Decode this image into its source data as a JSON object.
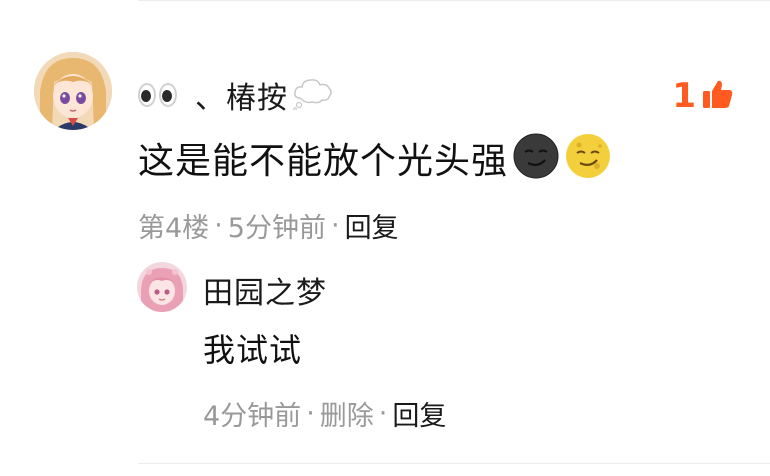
{
  "comment": {
    "username": "、椿按",
    "text": "这是能不能放个光头强",
    "like_count": "1",
    "floor": "第4楼",
    "time": "5分钟前",
    "reply_action": "回复",
    "separator": "·",
    "emojis": [
      "smirk-dark-face-emoji",
      "smirk-moon-face-emoji"
    ]
  },
  "reply": {
    "username": "田园之梦",
    "text": "我试试",
    "time": "4分钟前",
    "delete_action": "删除",
    "reply_action": "回复",
    "separator": "·"
  },
  "colors": {
    "accent_like": "#ff5a1f",
    "meta_gray": "#999999",
    "text_primary": "#111111"
  }
}
